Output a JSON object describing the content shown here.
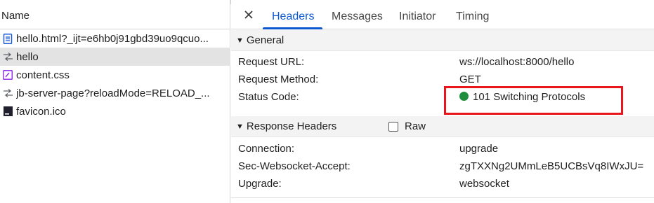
{
  "network_list": {
    "column_header": "Name",
    "requests": [
      {
        "name": "hello.html?_ijt=e6hb0j91gbd39uo9qcuo...",
        "icon": "document-icon"
      },
      {
        "name": "hello",
        "icon": "websocket-icon"
      },
      {
        "name": "content.css",
        "icon": "stylesheet-icon"
      },
      {
        "name": "jb-server-page?reloadMode=RELOAD_...",
        "icon": "websocket-icon"
      },
      {
        "name": "favicon.ico",
        "icon": "favicon-icon"
      }
    ]
  },
  "details": {
    "close_icon": "close-icon",
    "tabs": [
      {
        "label": "Headers",
        "active": true
      },
      {
        "label": "Messages",
        "active": false
      },
      {
        "label": "Initiator",
        "active": false
      },
      {
        "label": "Timing",
        "active": false
      }
    ],
    "general": {
      "title": "General",
      "rows": [
        {
          "key": "Request URL:",
          "value": "ws://localhost:8000/hello"
        },
        {
          "key": "Request Method:",
          "value": "GET"
        },
        {
          "key": "Status Code:",
          "value": "101 Switching Protocols"
        }
      ]
    },
    "response_headers": {
      "title": "Response Headers",
      "raw_label": "Raw",
      "raw_checked": false,
      "rows": [
        {
          "key": "Connection:",
          "value": "upgrade"
        },
        {
          "key": "Sec-Websocket-Accept:",
          "value": "zgTXXNg2UMmLeB5UCBsVq8IWxJU="
        },
        {
          "key": "Upgrade:",
          "value": "websocket"
        }
      ]
    }
  },
  "colors": {
    "accent": "#0b57d0",
    "status_ok": "#1e8e3e",
    "highlight": "#e8161b"
  }
}
